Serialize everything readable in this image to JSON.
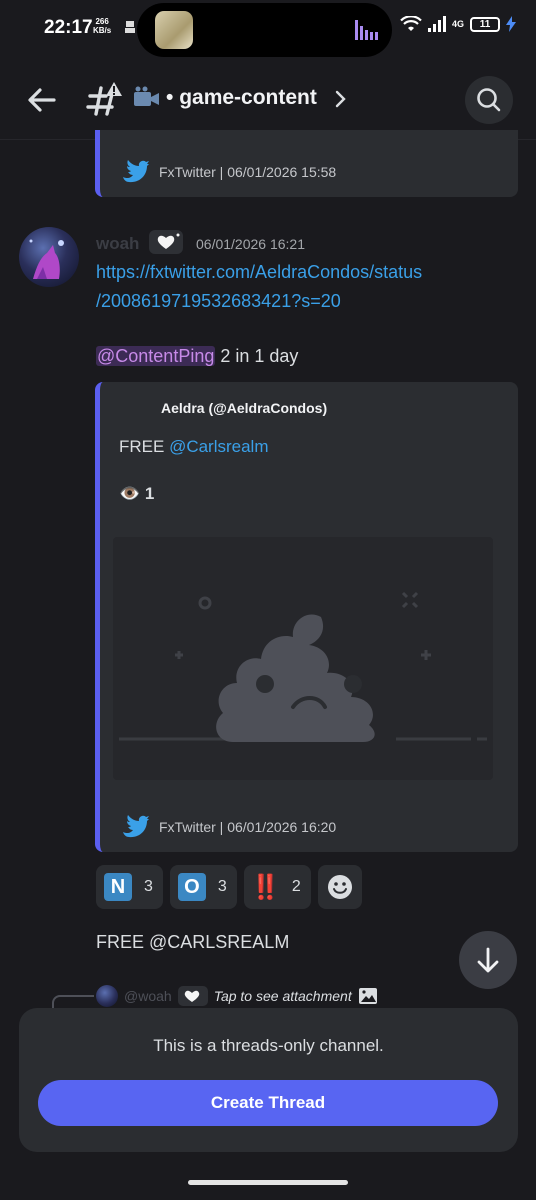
{
  "status_bar": {
    "time": "22:17",
    "speed_value": "266",
    "speed_unit": "KB/s",
    "network": "4G",
    "battery": "11"
  },
  "header": {
    "channel_name": "game-content"
  },
  "top_embed": {
    "footer": "FxTwitter | 06/01/2026 15:58"
  },
  "message": {
    "author": "woah",
    "timestamp": "06/01/2026 16:21",
    "link_line1": "https://fxtwitter.com/AeldraCondos/status",
    "link_line2": "/2008619719532683421?s=20",
    "mention": "@ContentPing",
    "after_mention": " 2 in 1 day"
  },
  "embed": {
    "author": "Aeldra (@AeldraCondos)",
    "desc_prefix": "FREE ",
    "desc_mention": "@Carlsrealm",
    "views_emoji": "👁️",
    "views_count": "1",
    "footer": "FxTwitter | 06/01/2026 16:20"
  },
  "reactions": [
    {
      "emoji": "N",
      "count": "3",
      "color": "#3b88c3"
    },
    {
      "emoji": "O",
      "count": "3",
      "color": "#3b88c3"
    },
    {
      "emoji": "‼️",
      "count": "2",
      "color": "#be1931"
    }
  ],
  "second_message": {
    "text": "FREE @CARLSREALM"
  },
  "reply_preview": {
    "author": "@woah",
    "text": "Tap to see attachment"
  },
  "bottom_panel": {
    "info": "This is a threads-only channel.",
    "button": "Create Thread"
  },
  "colors": {
    "accent": "#5865f2",
    "link": "#3aa0e8",
    "mention": "#c78ae8"
  }
}
